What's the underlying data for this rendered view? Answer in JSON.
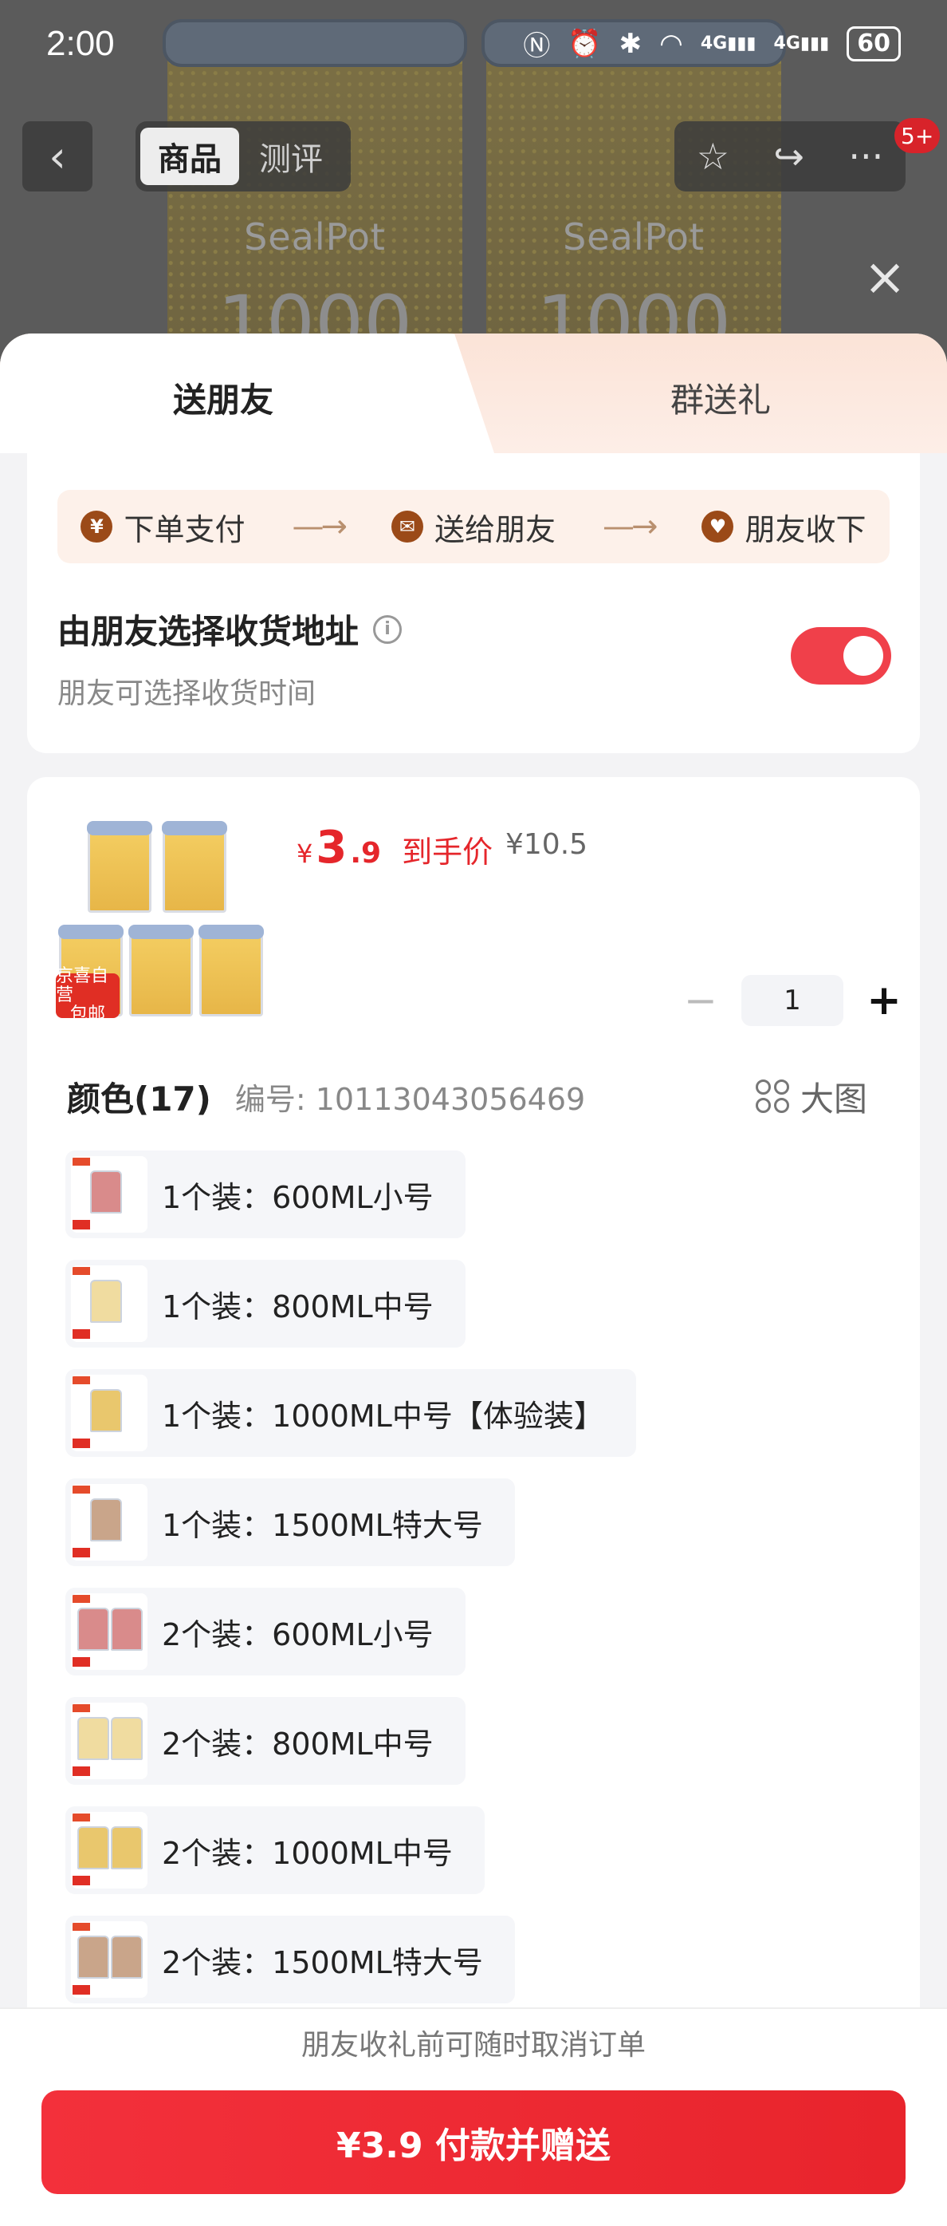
{
  "status_bar": {
    "time": "2:00",
    "battery": "60",
    "network_a": "4G",
    "network_b": "4G"
  },
  "background": {
    "jar_brand": "SealPot",
    "jar_volume": "1000"
  },
  "nav": {
    "tab_product": "商品",
    "tab_review": "测评",
    "badge": "5+"
  },
  "sheet": {
    "tabs": [
      {
        "label": "送朋友"
      },
      {
        "label": "群送礼"
      }
    ],
    "steps": [
      {
        "icon": "yuan-icon",
        "label": "下单支付"
      },
      {
        "icon": "wechat-icon",
        "label": "送给朋友"
      },
      {
        "icon": "gift-icon",
        "label": "朋友收下"
      }
    ],
    "address_title": "由朋友选择收货地址",
    "address_sub": "朋友可选择收货时间",
    "toggle_on": true,
    "accent": "#f0404a"
  },
  "product": {
    "badge_line1": "京喜自营",
    "badge_line2": "包邮",
    "currency": "¥",
    "price_int": "3",
    "price_dec": ".9",
    "price_label": "到手价",
    "old_price": "¥10.5",
    "quantity": "1",
    "spec_title": "颜色(17)",
    "sku": "编号: 10113043056469",
    "big_image_label": "大图",
    "options": [
      {
        "label": "1个装：600ML小号"
      },
      {
        "label": "1个装：800ML中号"
      },
      {
        "label": "1个装：1000ML中号【体验装】"
      },
      {
        "label": "1个装：1500ML特大号"
      },
      {
        "label": "2个装：600ML小号"
      },
      {
        "label": "2个装：800ML中号"
      },
      {
        "label": "2个装：1000ML中号"
      },
      {
        "label": "2个装：1500ML特大号"
      }
    ]
  },
  "footer": {
    "note": "朋友收礼前可随时取消订单",
    "pay_button": "¥3.9 付款并赠送"
  }
}
